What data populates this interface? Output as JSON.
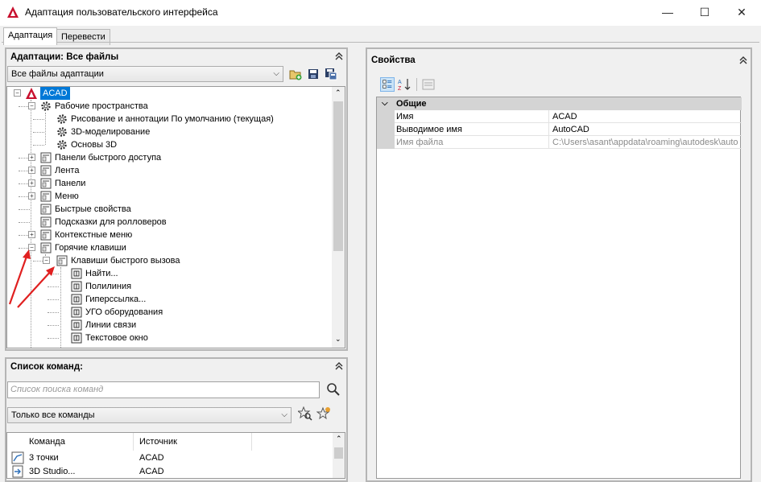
{
  "window": {
    "title": "Адаптация пользовательского интерфейса",
    "minimize": "—",
    "maximize": "☐",
    "close": "✕"
  },
  "tabs": [
    {
      "label": "Адаптация",
      "active": true
    },
    {
      "label": "Перевести",
      "active": false
    }
  ],
  "adapt_panel": {
    "title": "Адаптации: Все файлы",
    "file_filter": "Все файлы адаптации",
    "tree": [
      {
        "label": "ACAD",
        "icon": "autocad-logo-icon",
        "selected": true
      },
      {
        "label": "Рабочие пространства",
        "icon": "workspace-gear-icon"
      },
      {
        "label": "Рисование и аннотации По умолчанию (текущая)",
        "icon": "gear-icon"
      },
      {
        "label": "3D-моделирование",
        "icon": "gear-icon"
      },
      {
        "label": "Основы 3D",
        "icon": "gear-icon"
      },
      {
        "label": "Панели быстрого доступа",
        "icon": "quick-access-toolbar-icon"
      },
      {
        "label": "Лента",
        "icon": "ribbon-icon"
      },
      {
        "label": "Панели",
        "icon": "toolbars-icon"
      },
      {
        "label": "Меню",
        "icon": "menu-icon"
      },
      {
        "label": "Быстрые свойства",
        "icon": "quick-properties-icon"
      },
      {
        "label": "Подсказки для ролловеров",
        "icon": "rollover-tooltip-icon"
      },
      {
        "label": "Контекстные меню",
        "icon": "shortcut-menu-icon"
      },
      {
        "label": "Горячие клавиши",
        "icon": "keyboard-shortcut-icon"
      },
      {
        "label": "Клавиши быстрого вызова",
        "icon": "shortcut-keys-icon"
      },
      {
        "label": "Найти...",
        "icon": "key-command-icon"
      },
      {
        "label": "Полилиния",
        "icon": "key-command-icon"
      },
      {
        "label": "Гиперссылка...",
        "icon": "key-command-icon"
      },
      {
        "label": "УГО оборудования",
        "icon": "key-command-icon"
      },
      {
        "label": "Линии связи",
        "icon": "key-command-icon"
      },
      {
        "label": "Текстовое окно",
        "icon": "key-command-icon"
      }
    ]
  },
  "command_panel": {
    "title": "Список команд:",
    "search_placeholder": "Список поиска команд",
    "filter": "Только все команды",
    "columns": [
      "Команда",
      "Источник"
    ],
    "rows": [
      {
        "command": "3 точки",
        "source": "ACAD"
      },
      {
        "command": "3D Studio...",
        "source": "ACAD"
      }
    ]
  },
  "properties_panel": {
    "title": "Свойства",
    "category": "Общие",
    "rows": [
      {
        "name": "Имя",
        "value": "ACAD",
        "dim": false
      },
      {
        "name": "Выводимое имя",
        "value": "AutoCAD",
        "dim": false
      },
      {
        "name": "Имя файла",
        "value": "C:\\Users\\asant\\appdata\\roaming\\autodesk\\auto",
        "dim": true
      }
    ]
  },
  "colors": {
    "selection": "#0078d7",
    "annotation_arrow": "#e02020",
    "autocad_red": "#c8102e"
  }
}
